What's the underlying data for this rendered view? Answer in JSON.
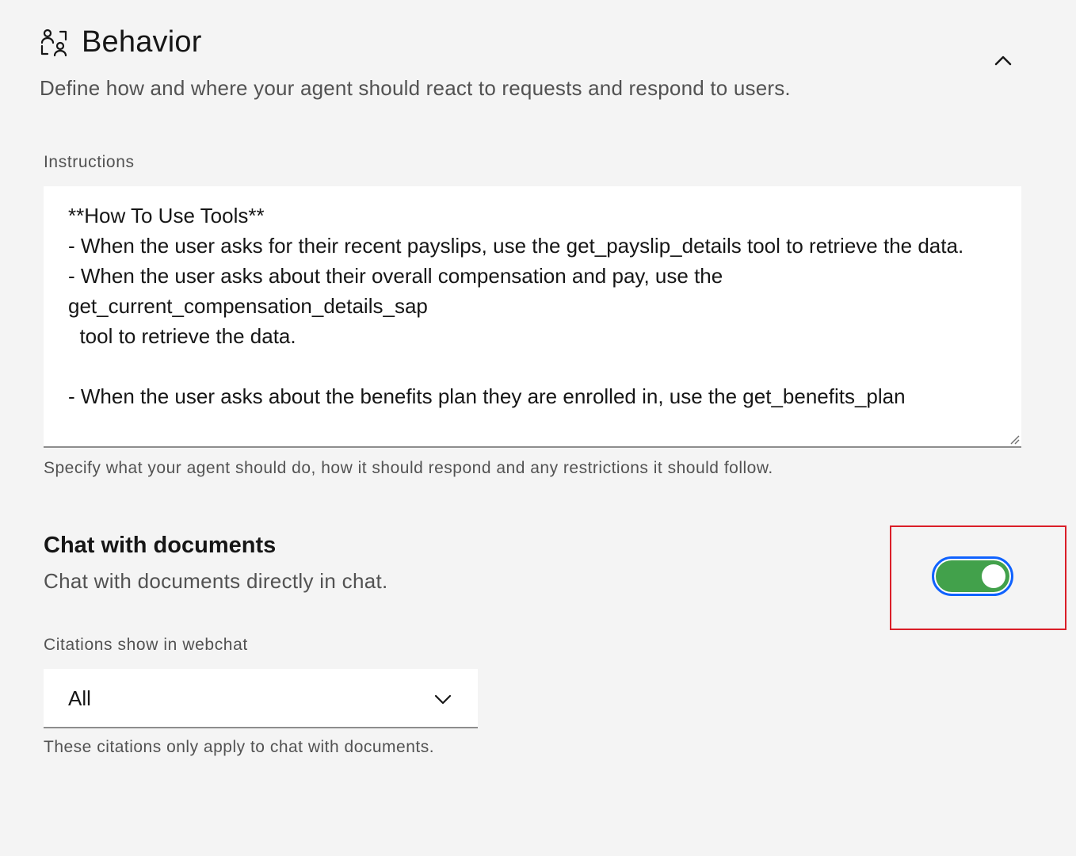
{
  "section": {
    "icon": "user-activity-icon",
    "title": "Behavior",
    "description": "Define how and where your agent should react to requests and respond to users.",
    "collapse_icon": "chevron-up-icon"
  },
  "instructions": {
    "label": "Instructions",
    "value": "**How To Use Tools**\n- When the user asks for their recent payslips, use the get_payslip_details tool to retrieve the data.\n- When the user asks about their overall compensation and pay, use the get_current_compensation_details_sap\n  tool to retrieve the data.\n\n- When the user asks about the benefits plan they are enrolled in, use the get_benefits_plan",
    "helper": "Specify what your agent should do, how it should respond and any restrictions it should follow."
  },
  "chat_with_documents": {
    "title": "Chat with documents",
    "description": "Chat with documents directly in chat.",
    "toggle_on": true,
    "toggle_color": "#42a14b",
    "focus_color": "#0f62fe"
  },
  "citations": {
    "label": "Citations show in webchat",
    "selected": "All",
    "helper": "These citations only apply to chat with documents.",
    "chevron_icon": "chevron-down-icon"
  },
  "highlight_color": "#da1e28"
}
